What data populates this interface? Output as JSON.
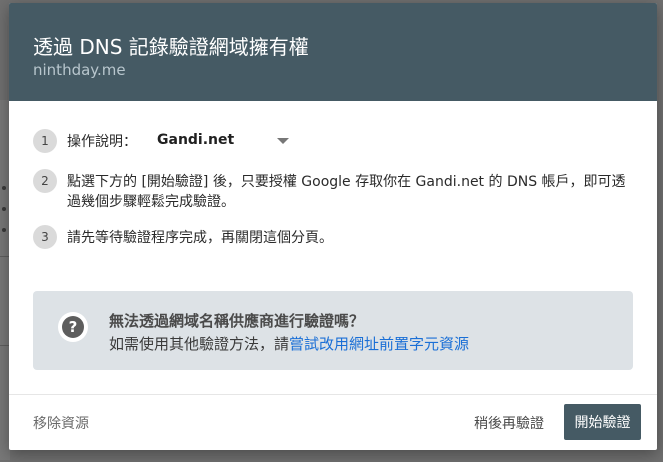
{
  "dialog": {
    "title": "透過 DNS 記錄驗證網域擁有權",
    "subtitle": "ninthday.me"
  },
  "steps": [
    {
      "number": "1",
      "text": "操作說明：",
      "provider": "Gandi.net"
    },
    {
      "number": "2",
      "text": "點選下方的 [開始驗證] 後，只要授權 Google 存取你在 Gandi.net 的 DNS 帳戶，即可透過幾個步驟輕鬆完成驗證。"
    },
    {
      "number": "3",
      "text": "請先等待驗證程序完成，再關閉這個分頁。"
    }
  ],
  "help": {
    "icon": "question-icon",
    "title": "無法透過網域名稱供應商進行驗證嗎？",
    "body_prefix": "如需使用其他驗證方法，請",
    "link": "嘗試改用網址前置字元資源"
  },
  "footer": {
    "remove_label": "移除資源",
    "later_label": "稍後再驗證",
    "start_label": "開始驗證"
  },
  "colors": {
    "header": "#455a64",
    "primary_button": "#455a64",
    "link": "#1a6fd6",
    "help_box": "#dde2e6"
  }
}
